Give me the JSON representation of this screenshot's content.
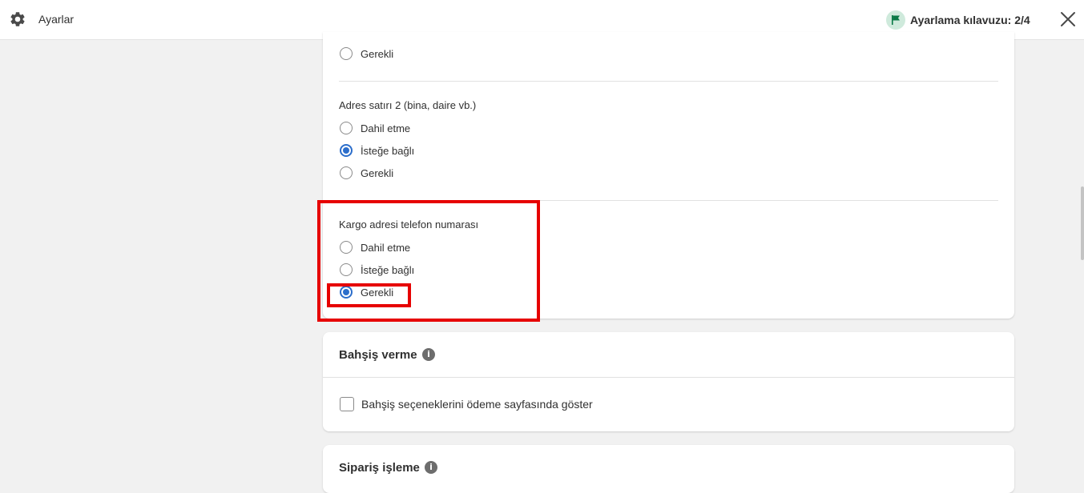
{
  "topbar": {
    "title": "Ayarlar",
    "guide_label": "Ayarlama kılavuzu: 2/4",
    "icons": {
      "settings": "gear-icon",
      "guide": "flag-icon",
      "close": "close-icon"
    }
  },
  "address_line_1": {
    "last_option": {
      "label": "Gerekli",
      "checked": false
    }
  },
  "address_line_2": {
    "label": "Adres satırı 2 (bina, daire vb.)",
    "options": [
      {
        "label": "Dahil etme",
        "checked": false
      },
      {
        "label": "İsteğe bağlı",
        "checked": true
      },
      {
        "label": "Gerekli",
        "checked": false
      }
    ]
  },
  "shipping_phone": {
    "label": "Kargo adresi telefon numarası",
    "options": [
      {
        "label": "Dahil etme",
        "checked": false
      },
      {
        "label": "İsteğe bağlı",
        "checked": false
      },
      {
        "label": "Gerekli",
        "checked": true
      }
    ]
  },
  "tipping": {
    "title": "Bahşiş verme",
    "checkbox_label": "Bahşiş seçeneklerini ödeme sayfasında göster",
    "checked": false
  },
  "order_processing": {
    "title": "Sipariş işleme"
  },
  "colors": {
    "accent": "#2c6ecb",
    "highlight": "#e60000",
    "guide_flag": "#0b7a47"
  }
}
